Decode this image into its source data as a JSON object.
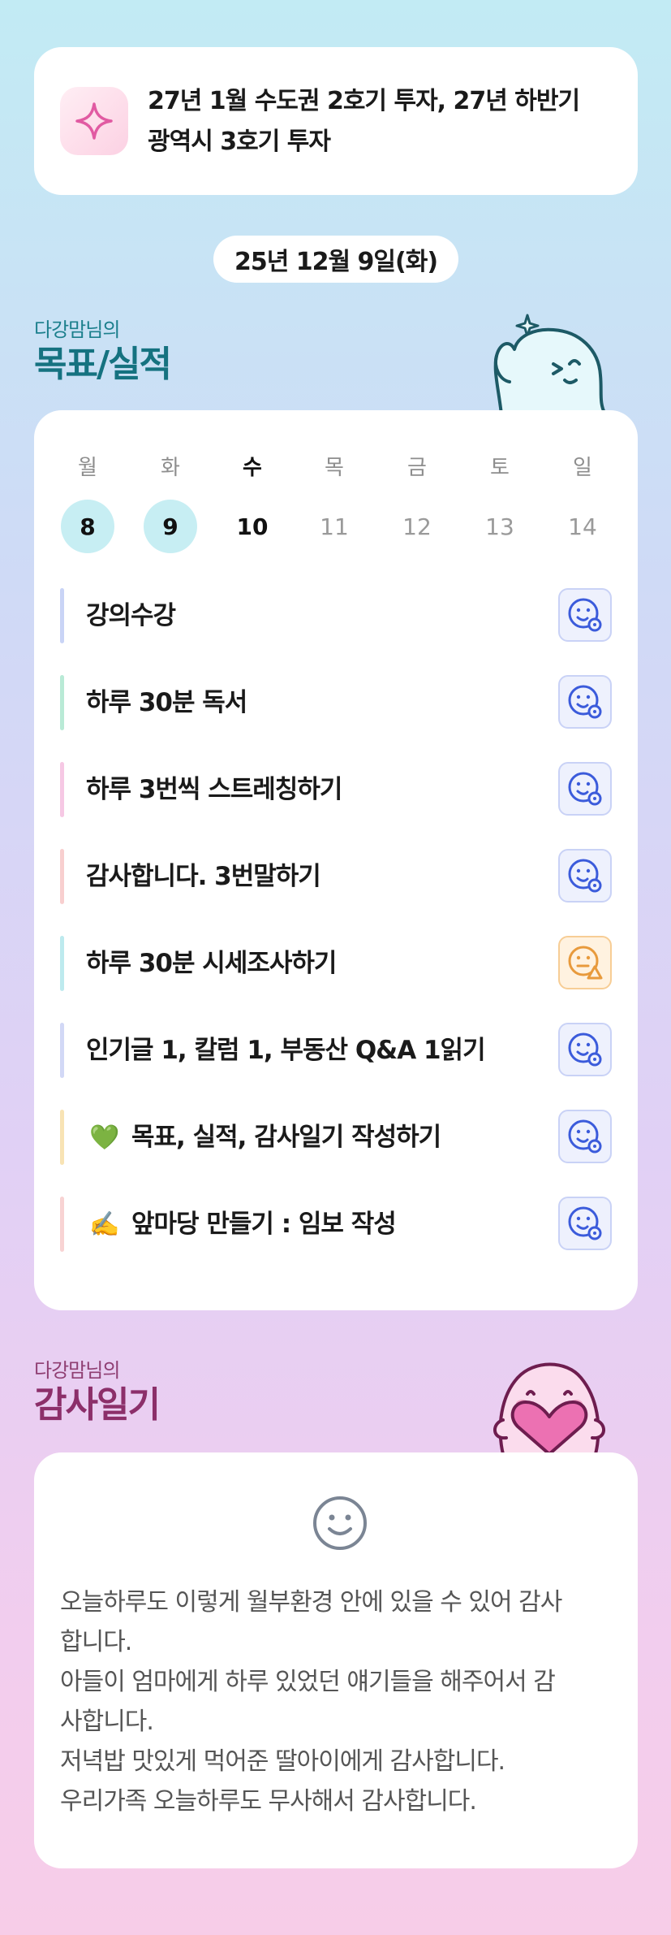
{
  "goal": {
    "icon": "sparkle-icon",
    "lines": [
      "27년 1월 수도권 2호기 투자, 27년 하반기",
      "광역시 3호기 투자"
    ]
  },
  "date_label": "25년 12월 9일(화)",
  "goals_section": {
    "subtitle": "다강맘님의",
    "title": "목표/실적",
    "mascot": "waving-mascot"
  },
  "week": {
    "days": [
      {
        "weekday": "월",
        "date": "8",
        "state": "done"
      },
      {
        "weekday": "화",
        "date": "9",
        "state": "done"
      },
      {
        "weekday": "수",
        "date": "10",
        "state": "today"
      },
      {
        "weekday": "목",
        "date": "11",
        "state": "future"
      },
      {
        "weekday": "금",
        "date": "12",
        "state": "future"
      },
      {
        "weekday": "토",
        "date": "13",
        "state": "future"
      },
      {
        "weekday": "일",
        "date": "14",
        "state": "future"
      }
    ]
  },
  "tasks": [
    {
      "label": "강의수강",
      "bar_color": "#c9d4f6",
      "status": "ok"
    },
    {
      "label": "하루 30분 독서",
      "bar_color": "#b9ead6",
      "status": "ok"
    },
    {
      "label": "하루 3번씩 스트레칭하기",
      "bar_color": "#f6c8e4",
      "status": "ok"
    },
    {
      "label": "감사합니다. 3번말하기",
      "bar_color": "#f8cfcf",
      "status": "ok"
    },
    {
      "label": "하루 30분 시세조사하기",
      "bar_color": "#bdeaee",
      "status": "warn"
    },
    {
      "label": "인기글 1, 칼럼 1, 부동산 Q&A 1읽기",
      "bar_color": "#d2d8f6",
      "status": "ok"
    },
    {
      "label": "목표, 실적, 감사일기 작성하기",
      "emoji": "💚",
      "bar_color": "#f8e3b4",
      "status": "ok"
    },
    {
      "label": "앞마당 만들기 : 임보 작성",
      "emoji": "✍️",
      "bar_color": "#f8d3d3",
      "status": "ok"
    }
  ],
  "diary_section": {
    "subtitle": "다강맘님의",
    "title": "감사일기",
    "mascot": "heart-hugging-mascot",
    "face_icon": "smile-face-icon",
    "lines": [
      "오늘하루도 이렇게 월부환경 안에 있을 수 있어 감사",
      "합니다.",
      "아들이 엄마에게 하루 있었던 얘기들을 해주어서 감",
      "사합니다.",
      "저녁밥 맛있게 먹어준 딸아이에게 감사합니다.",
      "우리가족 오늘하루도 무사해서 감사합니다."
    ]
  },
  "colors": {
    "teal_title": "#157280",
    "plum_title": "#8c2f6a",
    "done_circle": "#c7eef3",
    "ok_icon": "#3b5bdb",
    "warn_icon": "#e89a3c"
  }
}
